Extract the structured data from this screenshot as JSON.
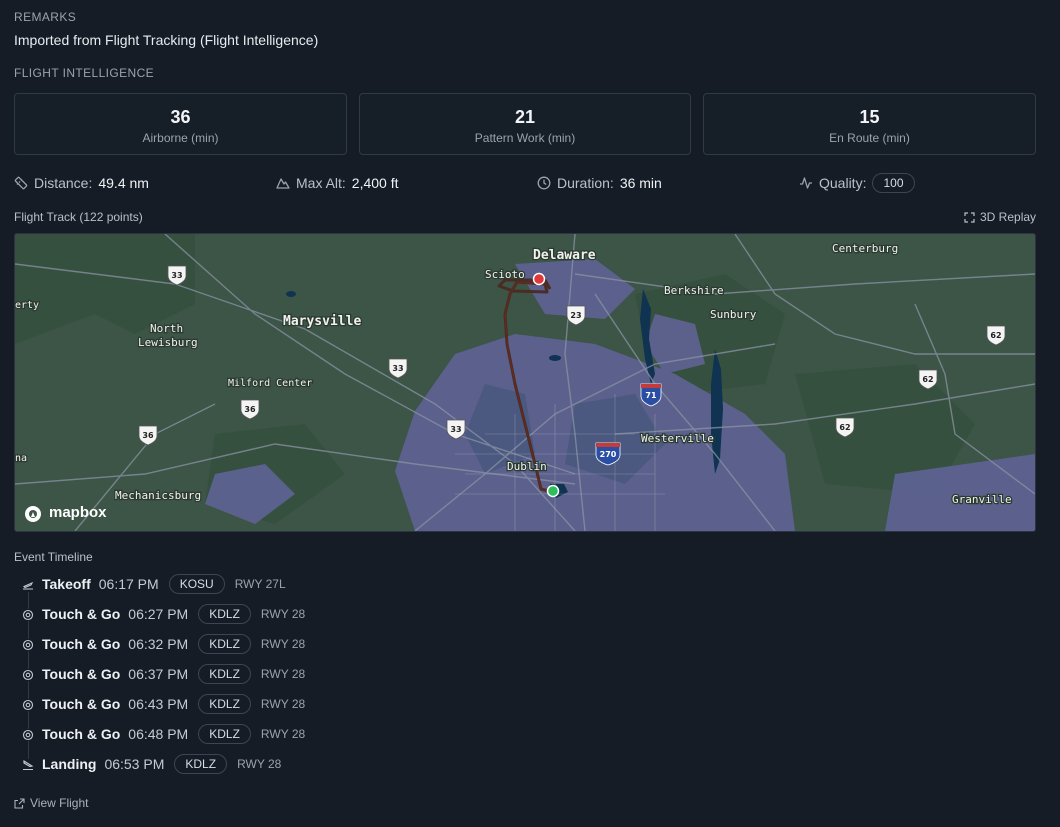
{
  "remarks": {
    "label": "REMARKS",
    "text": "Imported from Flight Tracking (Flight Intelligence)"
  },
  "flight_intelligence": {
    "label": "FLIGHT INTELLIGENCE",
    "cards": [
      {
        "value": "36",
        "label": "Airborne (min)"
      },
      {
        "value": "21",
        "label": "Pattern Work (min)"
      },
      {
        "value": "15",
        "label": "En Route (min)"
      }
    ]
  },
  "metrics": {
    "distance": {
      "label": "Distance:",
      "value": "49.4 nm",
      "icon": "ruler-icon"
    },
    "max_alt": {
      "label": "Max Alt:",
      "value": "2,400 ft",
      "icon": "mountain-icon"
    },
    "duration": {
      "label": "Duration:",
      "value": "36 min",
      "icon": "clock-icon"
    },
    "quality": {
      "label": "Quality:",
      "value": "100",
      "icon": "activity-icon"
    }
  },
  "track": {
    "title": "Flight Track (122 points)",
    "replay_label": "3D Replay"
  },
  "map": {
    "attribution": "mapbox",
    "places": [
      "Delaware",
      "Centerburg",
      "Berkshire",
      "Sunbury",
      "Marysville",
      "North",
      "Lewisburg",
      "Milford Center",
      "Westerville",
      "Dublin",
      "Mechanicsburg",
      "Granville",
      "Scioto",
      "erty",
      "na"
    ],
    "shields": [
      "33",
      "33",
      "33",
      "23",
      "36",
      "36",
      "71",
      "270",
      "62",
      "62",
      "62"
    ],
    "colors": {
      "land": "#3c5546",
      "urban": "#5d6290",
      "water": "#0f3350",
      "road": "#8a93a6",
      "track": "#4a2a22",
      "start": "#2fbf5a",
      "end": "#e0393b"
    }
  },
  "timeline": {
    "label": "Event Timeline",
    "events": [
      {
        "type": "Takeoff",
        "time": "06:17 PM",
        "airport": "KOSU",
        "runway": "RWY 27L",
        "icon": "takeoff-icon"
      },
      {
        "type": "Touch & Go",
        "time": "06:27 PM",
        "airport": "KDLZ",
        "runway": "RWY 28",
        "icon": "target-icon"
      },
      {
        "type": "Touch & Go",
        "time": "06:32 PM",
        "airport": "KDLZ",
        "runway": "RWY 28",
        "icon": "target-icon"
      },
      {
        "type": "Touch & Go",
        "time": "06:37 PM",
        "airport": "KDLZ",
        "runway": "RWY 28",
        "icon": "target-icon"
      },
      {
        "type": "Touch & Go",
        "time": "06:43 PM",
        "airport": "KDLZ",
        "runway": "RWY 28",
        "icon": "target-icon"
      },
      {
        "type": "Touch & Go",
        "time": "06:48 PM",
        "airport": "KDLZ",
        "runway": "RWY 28",
        "icon": "target-icon"
      },
      {
        "type": "Landing",
        "time": "06:53 PM",
        "airport": "KDLZ",
        "runway": "RWY 28",
        "icon": "landing-icon"
      }
    ]
  },
  "footer": {
    "view_flight_label": "View Flight",
    "icon": "external-link-icon"
  }
}
